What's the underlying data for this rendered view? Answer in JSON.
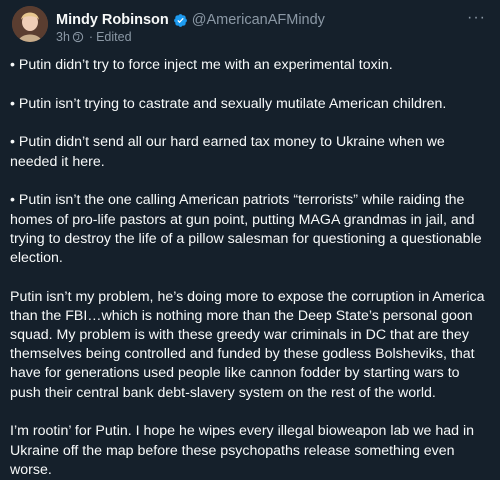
{
  "author": {
    "name": "Mindy Robinson",
    "handle": "@AmericanAFMindy",
    "verified_color": "#1d9bf0"
  },
  "meta": {
    "time": "3h",
    "separator": "·",
    "audience_icon": "world-icon",
    "edited": "Edited"
  },
  "more_label": "···",
  "paragraphs": [
    "• Putin didn’t try to force inject me with an experimental toxin.",
    "• Putin isn’t trying to castrate and sexually mutilate American children.",
    "• Putin didn’t send all our hard earned tax money to Ukraine when we needed it here.",
    "• Putin isn’t the one calling American patriots “terrorists” while raiding the homes of pro-life pastors at gun point, putting MAGA grandmas in jail, and trying to destroy the life of a pillow salesman for questioning a questionable election.",
    "Putin isn’t my problem, he’s doing more to expose the corruption in America than the FBI…which is nothing more than the Deep State’s personal goon squad. My problem is with these greedy war criminals in DC that are they themselves being controlled and funded by these godless Bolsheviks, that have for generations used people like cannon fodder by starting wars to push their central bank debt-slavery system on the rest of the world.",
    "I’m rootin’ for Putin. I hope he wipes every illegal bioweapon lab we had in Ukraine off the map before these psychopaths release something even worse."
  ]
}
